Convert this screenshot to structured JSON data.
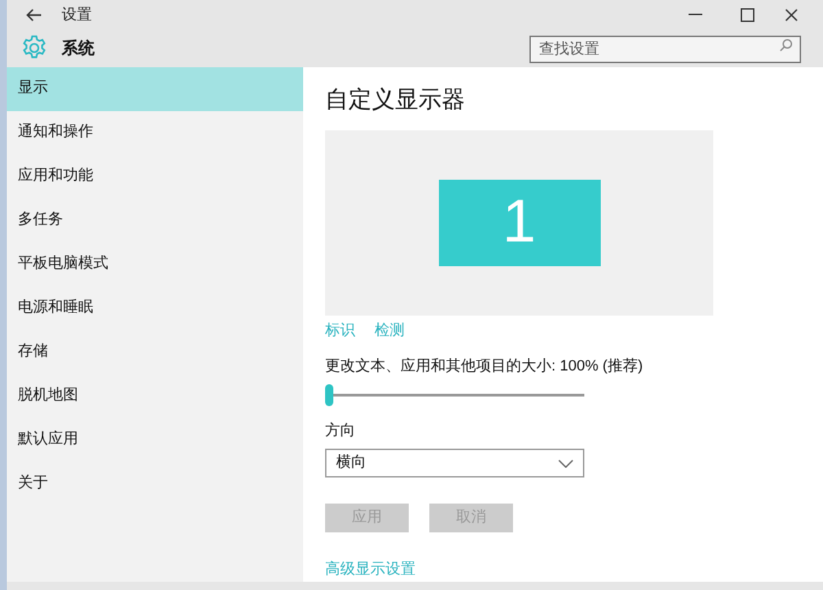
{
  "window": {
    "title": "设置"
  },
  "header": {
    "title": "系统",
    "search": {
      "placeholder": "查找设置"
    }
  },
  "sidebar": {
    "items": [
      {
        "label": "显示",
        "selected": true
      },
      {
        "label": "通知和操作",
        "selected": false
      },
      {
        "label": "应用和功能",
        "selected": false
      },
      {
        "label": "多任务",
        "selected": false
      },
      {
        "label": "平板电脑模式",
        "selected": false
      },
      {
        "label": "电源和睡眠",
        "selected": false
      },
      {
        "label": "存储",
        "selected": false
      },
      {
        "label": "脱机地图",
        "selected": false
      },
      {
        "label": "默认应用",
        "selected": false
      },
      {
        "label": "关于",
        "selected": false
      }
    ]
  },
  "content": {
    "title": "自定义显示器",
    "display_number": "1",
    "links": [
      "标识",
      "检测"
    ],
    "scale": {
      "label": "更改文本、应用和其他项目的大小: 100% (推荐)",
      "level": 0
    },
    "orientation": {
      "label": "方向",
      "value": "横向"
    },
    "buttons": [
      {
        "label": "应用",
        "disabled": true
      },
      {
        "label": "取消",
        "disabled": true
      }
    ],
    "advanced_link": "高级显示设置"
  }
}
